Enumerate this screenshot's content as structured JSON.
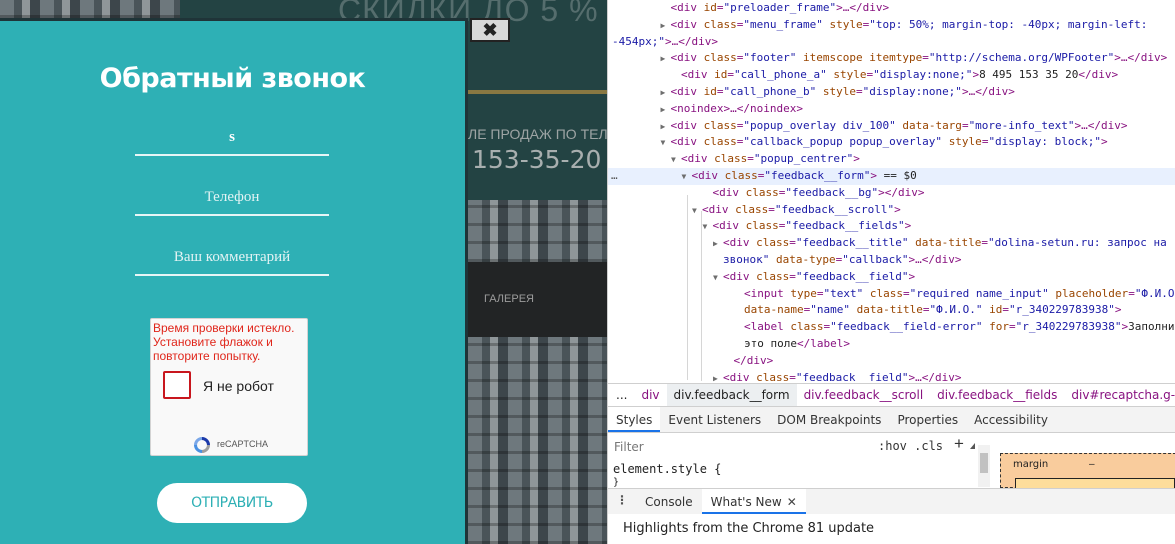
{
  "site": {
    "promo_text": "СКИДКИ ДО 5 %",
    "sales_text": "ЛЕ ПРОДАЖ ПО ТЕЛ",
    "sales_phone": "153-35-20",
    "nav_gallery": "ГАЛЕРЕЯ",
    "close_symbol": "✖"
  },
  "popup": {
    "title": "Обратный звонок",
    "name_value": "s",
    "phone_placeholder": "Телефон",
    "comment_placeholder": "Ваш комментарий",
    "recaptcha": {
      "error": "Время проверки истекло. Установите флажок и повторите попытку.",
      "label": "Я не робот",
      "brand": "reCAPTCHA"
    },
    "submit_label": "ОТПРАВИТЬ"
  },
  "devtools": {
    "dom_lines": [
      {
        "indent": 5,
        "arrow": "",
        "html": "<span class='tag'>&lt;div</span> <span class='an'>id</span>=<span class='av'>\"preloader_frame\"</span><span class='tag'>&gt;</span>…<span class='tag'>&lt;/div&gt;</span>"
      },
      {
        "indent": 5,
        "arrow": "▶",
        "html": "<span class='tag'>&lt;div</span> <span class='an'>class</span>=<span class='av'>\"menu_frame\"</span> <span class='an'>style</span>=<span class='av'>\"top: 50%; margin-top: -40px; margin-left:</span>"
      },
      {
        "indent": 0,
        "arrow": "",
        "html": "<span class='av'>-454px;\"</span><span class='tag'>&gt;</span>…<span class='tag'>&lt;/div&gt;</span>"
      },
      {
        "indent": 5,
        "arrow": "▶",
        "html": "<span class='tag'>&lt;div</span> <span class='an'>class</span>=<span class='av'>\"footer\"</span> <span class='an'>itemscope</span> <span class='an'>itemtype</span>=<span class='av'>\"http://schema.org/WPFooter\"</span><span class='tag'>&gt;</span>…<span class='tag'>&lt;/div&gt;</span>"
      },
      {
        "indent": 6,
        "arrow": "",
        "html": "<span class='tag'>&lt;div</span> <span class='an'>id</span>=<span class='av'>\"call_phone_a\"</span> <span class='an'>style</span>=<span class='av'>\"display:none;\"</span><span class='tag'>&gt;</span><span class='tx'>8 495 153 35 20</span><span class='tag'>&lt;/div&gt;</span>"
      },
      {
        "indent": 5,
        "arrow": "▶",
        "html": "<span class='tag'>&lt;div</span> <span class='an'>id</span>=<span class='av'>\"call_phone_b\"</span> <span class='an'>style</span>=<span class='av'>\"display:none;\"</span><span class='tag'>&gt;</span>…<span class='tag'>&lt;/div&gt;</span>"
      },
      {
        "indent": 5,
        "arrow": "▶",
        "html": "<span class='tag'>&lt;noindex&gt;</span>…<span class='tag'>&lt;/noindex&gt;</span>"
      },
      {
        "indent": 5,
        "arrow": "▶",
        "html": "<span class='tag'>&lt;div</span> <span class='an'>class</span>=<span class='av'>\"popup_overlay div_100\"</span> <span class='an'>data-targ</span>=<span class='av'>\"more-info_text\"</span><span class='tag'>&gt;</span>…<span class='tag'>&lt;/div&gt;</span>"
      },
      {
        "indent": 5,
        "arrow": "▼",
        "html": "<span class='tag'>&lt;div</span> <span class='an'>class</span>=<span class='av'>\"callback_popup popup_overlay\"</span> <span class='an'>style</span>=<span class='av'>\"display: block;\"</span><span class='tag'>&gt;</span>"
      },
      {
        "indent": 6,
        "arrow": "▼",
        "html": "<span class='tag'>&lt;div</span> <span class='an'>class</span>=<span class='av'>\"popup_centrer\"</span><span class='tag'>&gt;</span>"
      },
      {
        "indent": 7,
        "arrow": "▼",
        "html": "<span class='tag'>&lt;div</span> <span class='an'>class</span>=<span class='av'>\"feedback__form\"</span><span class='tag'>&gt;</span> <span class='tx'>== $0</span>",
        "selected": true
      },
      {
        "indent": 9,
        "arrow": "",
        "html": "<span class='tag'>&lt;div</span> <span class='an'>class</span>=<span class='av'>\"feedback__bg\"</span><span class='tag'>&gt;&lt;/div&gt;</span>"
      },
      {
        "indent": 8,
        "arrow": "▼",
        "html": "<span class='tag'>&lt;div</span> <span class='an'>class</span>=<span class='av'>\"feedback__scroll\"</span><span class='tag'>&gt;</span>"
      },
      {
        "indent": 9,
        "arrow": "▼",
        "html": "<span class='tag'>&lt;div</span> <span class='an'>class</span>=<span class='av'>\"feedback__fields\"</span><span class='tag'>&gt;</span>"
      },
      {
        "indent": 10,
        "arrow": "▶",
        "html": "<span class='tag'>&lt;div</span> <span class='an'>class</span>=<span class='av'>\"feedback__title\"</span> <span class='an'>data-title</span>=<span class='av'>\"dolina-setun.ru: запрос на</span>"
      },
      {
        "indent": 10,
        "arrow": "",
        "html": "<span class='av'>звонок\"</span> <span class='an'>data-type</span>=<span class='av'>\"callback\"</span><span class='tag'>&gt;</span>…<span class='tag'>&lt;/div&gt;</span>"
      },
      {
        "indent": 10,
        "arrow": "▼",
        "html": "<span class='tag'>&lt;div</span> <span class='an'>class</span>=<span class='av'>\"feedback__field\"</span><span class='tag'>&gt;</span>"
      },
      {
        "indent": 12,
        "arrow": "",
        "html": "<span class='tag'>&lt;input</span> <span class='an'>type</span>=<span class='av'>\"text\"</span> <span class='an'>class</span>=<span class='av'>\"required name_input\"</span> <span class='an'>placeholder</span>=<span class='av'>\"Ф.И.О.</span>"
      },
      {
        "indent": 12,
        "arrow": "",
        "html": "<span class='an'>data-name</span>=<span class='av'>\"name\"</span> <span class='an'>data-title</span>=<span class='av'>\"Ф.И.О.\"</span> <span class='an'>id</span>=<span class='av'>\"r_340229783938\"</span><span class='tag'>&gt;</span>"
      },
      {
        "indent": 12,
        "arrow": "",
        "html": "<span class='tag'>&lt;label</span> <span class='an'>class</span>=<span class='av'>\"feedback__field-error\"</span> <span class='an'>for</span>=<span class='av'>\"r_340229783938\"</span><span class='tag'>&gt;</span><span class='tx'>Заполнит</span>"
      },
      {
        "indent": 12,
        "arrow": "",
        "html": "<span class='tx'>это поле</span><span class='tag'>&lt;/label&gt;</span>"
      },
      {
        "indent": 11,
        "arrow": "",
        "html": "<span class='tag'>&lt;/div&gt;</span>"
      },
      {
        "indent": 10,
        "arrow": "▶",
        "html": "<span class='tag'>&lt;div</span> <span class='an'>class</span>=<span class='av'>\"feedback__field\"</span><span class='tag'>&gt;</span>…<span class='tag'>&lt;/div&gt;</span>"
      }
    ],
    "selected_dots": "…",
    "breadcrumbs": [
      "...",
      "div",
      "div.feedback__form",
      "div.feedback__scroll",
      "div.feedback__fields",
      "div#recaptcha.g-recaptcha"
    ],
    "breadcrumb_current": 2,
    "tabs": [
      "Styles",
      "Event Listeners",
      "DOM Breakpoints",
      "Properties",
      "Accessibility"
    ],
    "active_tab": 0,
    "filter_placeholder": "Filter",
    "hov_cls": ":hov .cls",
    "plus": "+",
    "element_style": "element.style {",
    "element_style_close": "}",
    "box_margin_label": "margin",
    "box_margin_value": "–",
    "drawer_menu": "⋮",
    "drawer_tabs": [
      "Console",
      "What's New"
    ],
    "drawer_active": 1,
    "drawer_close": "✕",
    "drawer_text": "Highlights from the Chrome 81 update"
  },
  "colors": {
    "popup_bg": "#2eb0b5",
    "error_red": "#e0261b",
    "devtools_accent": "#1a73e8"
  }
}
